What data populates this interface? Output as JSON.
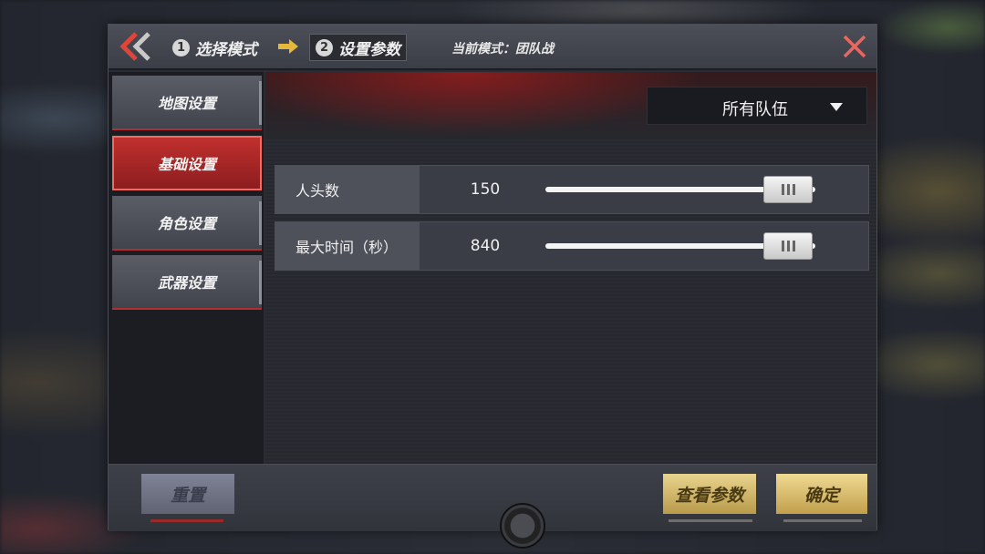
{
  "header": {
    "step1_num": "1",
    "step1_label": "选择模式",
    "step2_num": "2",
    "step2_label": "设置参数",
    "mode_text": "当前模式：团队战"
  },
  "sidebar": {
    "items": [
      {
        "label": "地图设置",
        "active": false
      },
      {
        "label": "基础设置",
        "active": true
      },
      {
        "label": "角色设置",
        "active": false
      },
      {
        "label": "武器设置",
        "active": false
      }
    ]
  },
  "team_select": {
    "value": "所有队伍"
  },
  "params": [
    {
      "label": "人头数",
      "value": "150",
      "slider_fraction": 0.9
    },
    {
      "label": "最大时间（秒）",
      "value": "840",
      "slider_fraction": 0.9
    }
  ],
  "footer": {
    "reset_label": "重置",
    "view_label": "查看参数",
    "ok_label": "确定"
  },
  "colors": {
    "accent_red": "#c0302e",
    "gold": "#e9d48e"
  }
}
